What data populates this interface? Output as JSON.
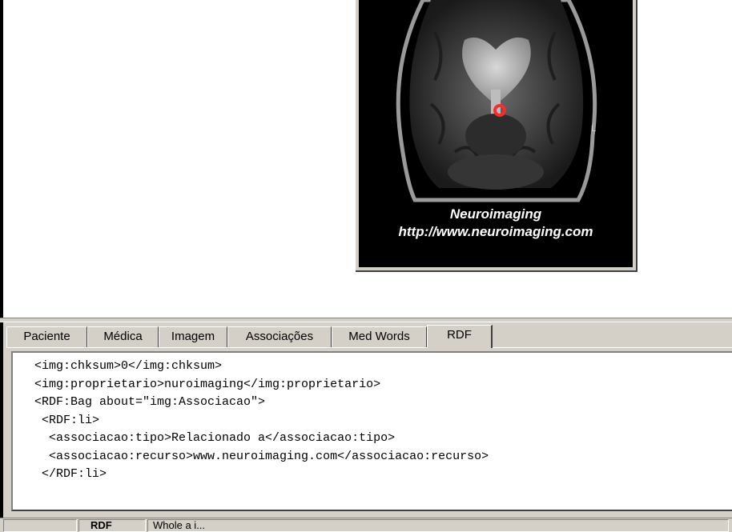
{
  "image": {
    "caption_line1": "Neuroimaging",
    "caption_line2": "http://www.neuroimaging.com",
    "marker_color": "#ff2a2a",
    "side_label": "L"
  },
  "tabs": [
    {
      "label": "Paciente"
    },
    {
      "label": "Médica"
    },
    {
      "label": "Imagem"
    },
    {
      "label": "Associações"
    },
    {
      "label": "Med Words"
    },
    {
      "label": "RDF",
      "active": true
    }
  ],
  "editor": {
    "lines": [
      "   <img:chksum>0</img:chksum>",
      "   <img:proprietario>nuroimaging</img:proprietario>",
      "   <RDF:Bag about=\"img:Associacao\">",
      "    <RDF:li>",
      "     <associacao:tipo>Relacionado a</associacao:tipo>",
      "     <associacao:recurso>www.neuroimaging.com</associacao:recurso>",
      "    </RDF:li>"
    ]
  },
  "statusbar": {
    "cell1": "",
    "cell2": "RDF",
    "cell3": "Whole a i..."
  }
}
